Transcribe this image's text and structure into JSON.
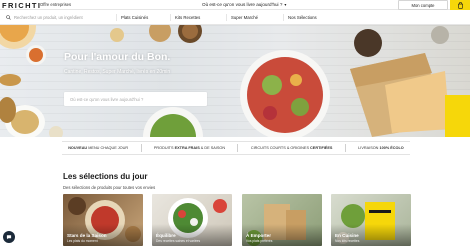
{
  "header": {
    "logo": "FRICHTI",
    "offre_label": "Offre entreprises",
    "question_label": "Où est-ce qu'on vous livre aujourd'hui ?",
    "account_label": "Mon compte"
  },
  "search": {
    "placeholder": "Recherchez un produit, un ingrédient"
  },
  "nav": {
    "items": [
      "Plats Cuisinés",
      "Kits Recettes",
      "Super Marché",
      "Nos Sélections"
    ]
  },
  "hero": {
    "title": "Pour l'amour du Bon.",
    "subtitle": "Cantine, Restos, Super Marché, livrés en 20min",
    "search_placeholder": "Où est-ce qu'on vous livre aujourd'hui ?"
  },
  "strip": {
    "items": [
      {
        "bold": "NOUVEAU",
        "rest": " MENU CHAQUE JOUR"
      },
      {
        "pre": "PRODUITS ",
        "bold": "EXTRA FRAIS",
        "rest": " & DE SAISON"
      },
      {
        "pre": "CIRCUITS COURTS & ORIGINES ",
        "bold": "CERTIFIÉES"
      },
      {
        "pre": "LIVRAISON ",
        "bold": "100% ÉCOLO"
      }
    ]
  },
  "selections": {
    "title": "Les sélections du jour",
    "subtitle": "Des sélections de produits pour toutes vos envies",
    "cards": [
      {
        "title": "Stars de la Saison",
        "subtitle": "Les plats du moment"
      },
      {
        "title": "Équilibre",
        "subtitle": "Des recettes saines et variées"
      },
      {
        "title": "À Emporter",
        "subtitle": "Vos plats préférés"
      },
      {
        "title": "En Cuisine",
        "subtitle": "Nos kits recettes"
      }
    ]
  },
  "colors": {
    "brand_yellow": "#f6d70a",
    "chat_bubble": "#1b2a3a"
  },
  "icons": {
    "cart": "shopping-bag-icon",
    "search": "search-icon",
    "chat": "chat-icon"
  }
}
